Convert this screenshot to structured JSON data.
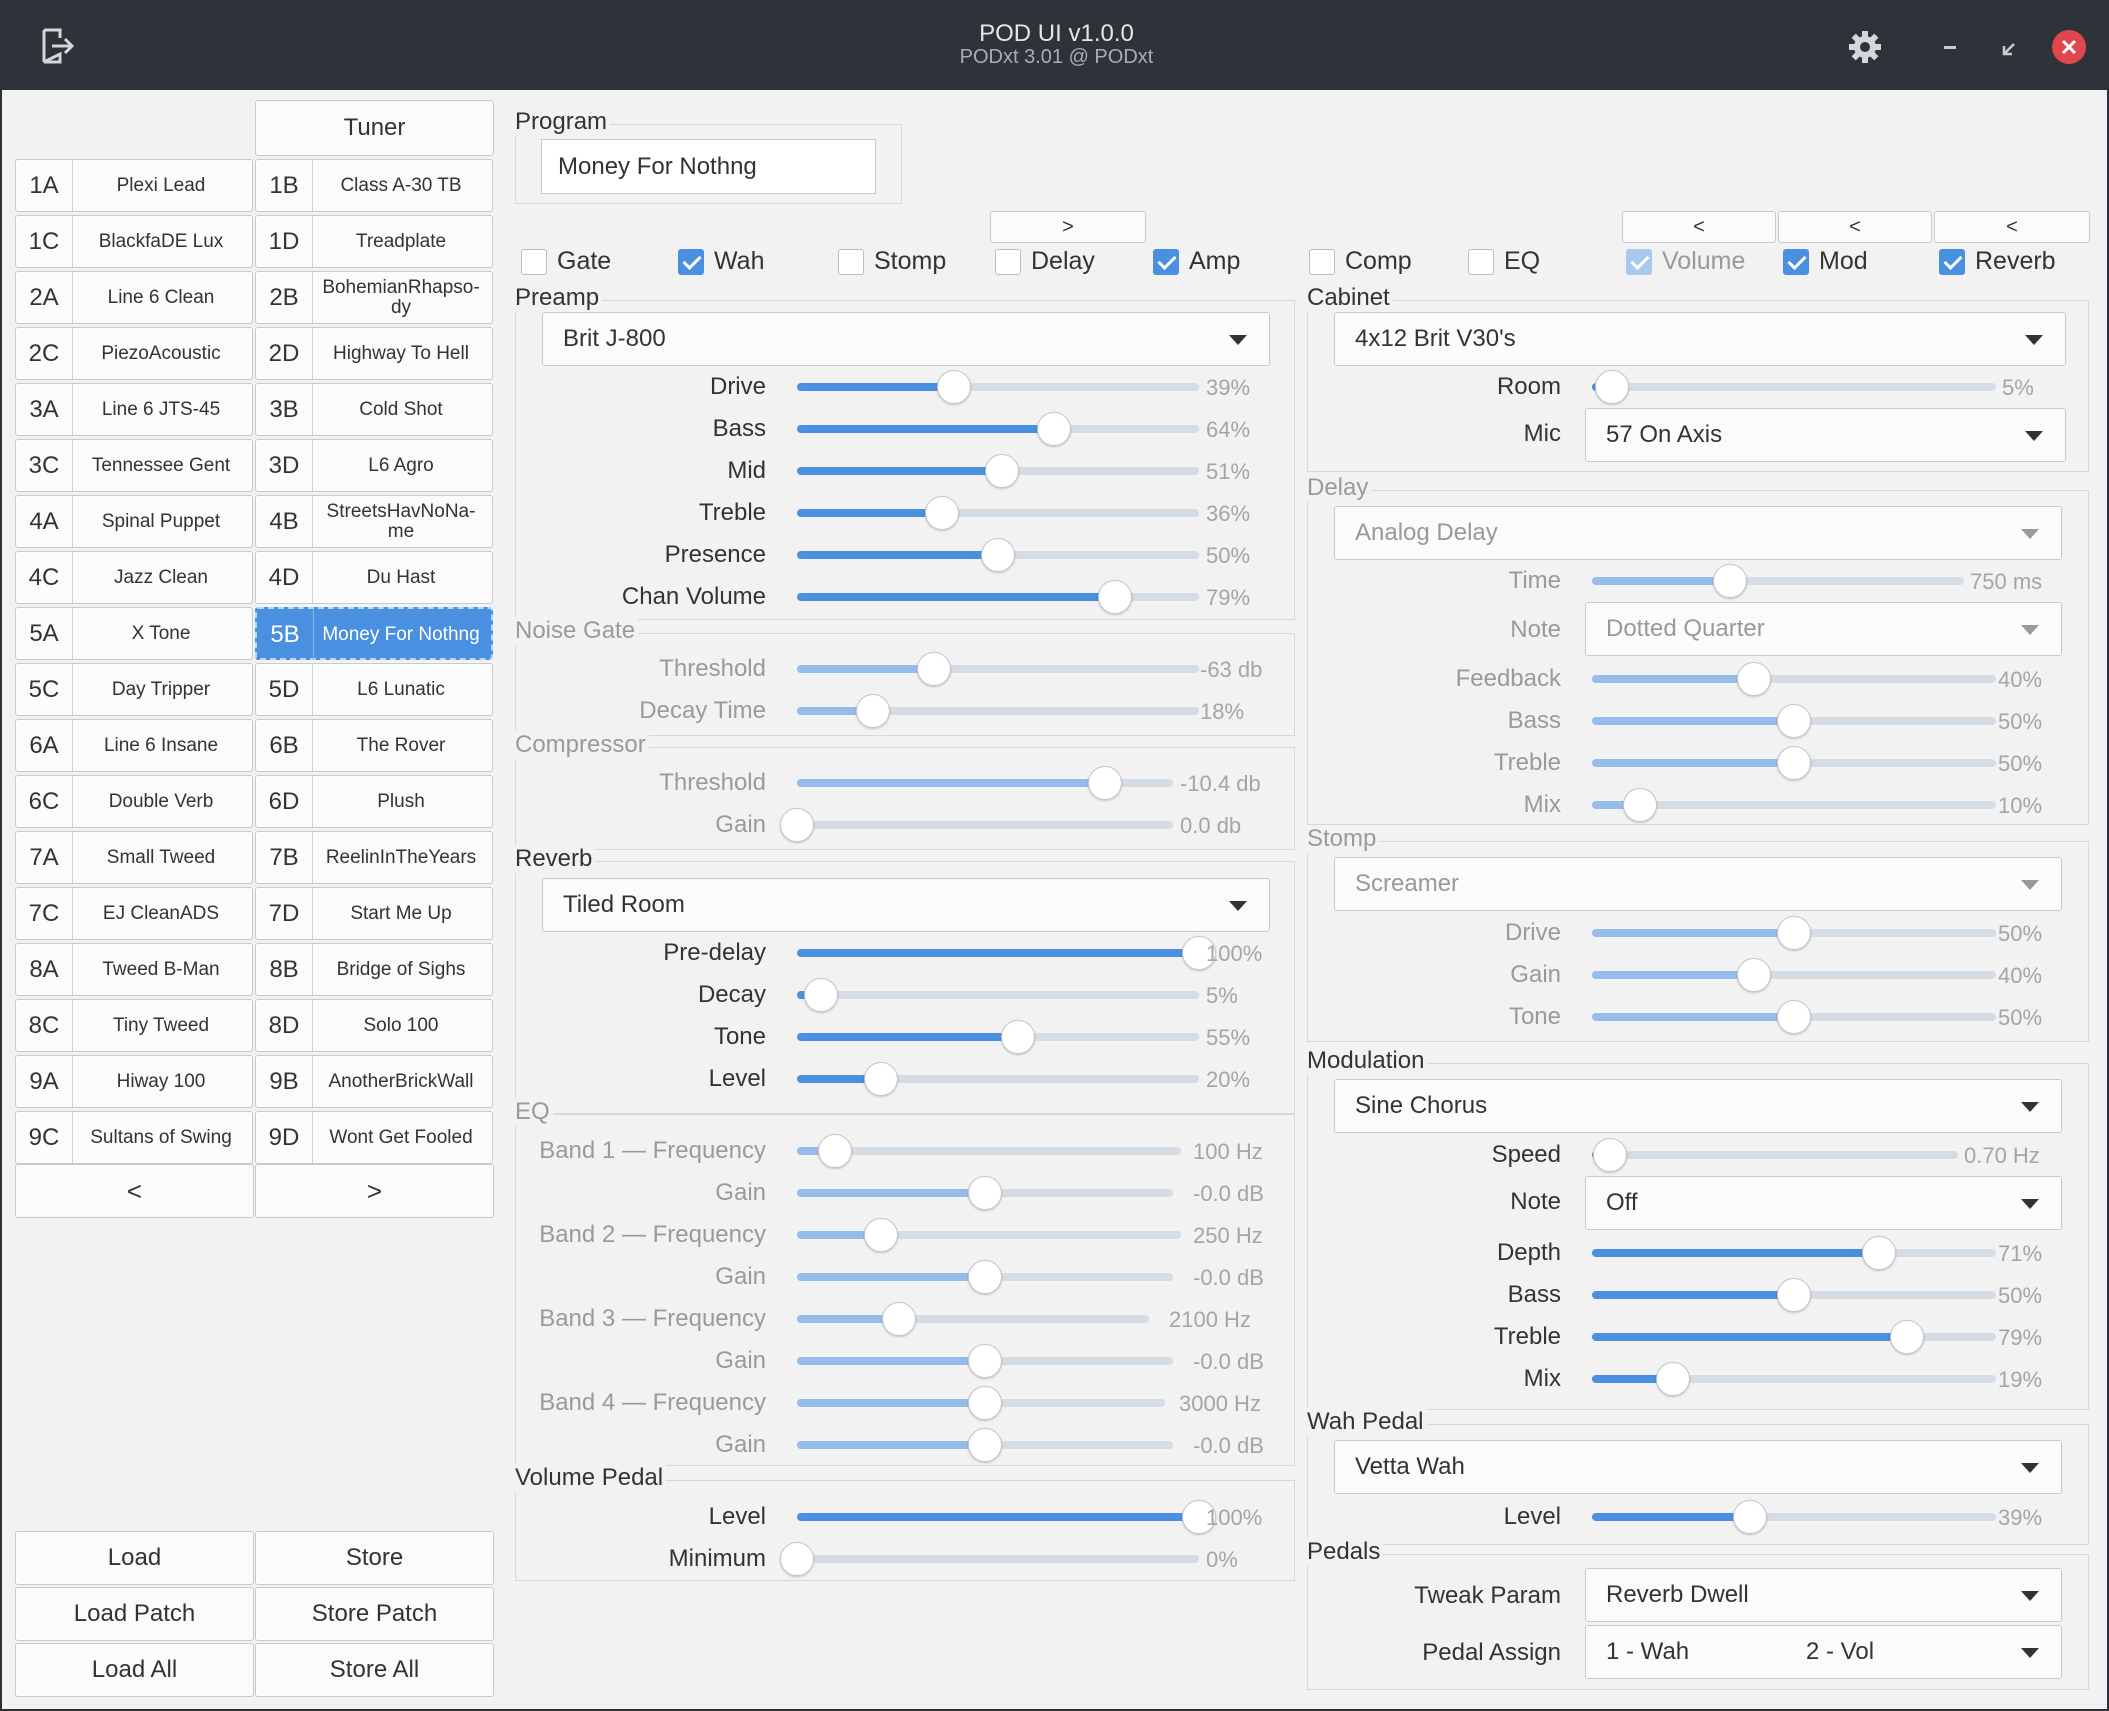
{
  "window": {
    "title": "POD UI v1.0.0",
    "subtitle": "PODxt 3.01 @ PODxt"
  },
  "icons": [
    "exit-icon",
    "gear-icon",
    "minimize-icon",
    "restore-icon",
    "close-icon",
    "chevron-down-icon",
    "checkbox-icon"
  ],
  "colors": {
    "accent": "#4a90e0",
    "titlebar": "#2f3339",
    "close": "#e0474c"
  },
  "sidebar": {
    "tuner": "Tuner",
    "patches": [
      {
        "code": "1A",
        "name": "Plexi Lead"
      },
      {
        "code": "1B",
        "name": "Class A-30 TB"
      },
      {
        "code": "1C",
        "name": "BlackfaDE Lux"
      },
      {
        "code": "1D",
        "name": "Treadplate"
      },
      {
        "code": "2A",
        "name": "Line 6 Clean"
      },
      {
        "code": "2B",
        "name": "BohemianRhapso-dy"
      },
      {
        "code": "2C",
        "name": "PiezoAcoustic"
      },
      {
        "code": "2D",
        "name": "Highway To Hell"
      },
      {
        "code": "3A",
        "name": "Line 6 JTS-45"
      },
      {
        "code": "3B",
        "name": "Cold Shot"
      },
      {
        "code": "3C",
        "name": "Tennessee Gent"
      },
      {
        "code": "3D",
        "name": "L6 Agro"
      },
      {
        "code": "4A",
        "name": "Spinal Puppet"
      },
      {
        "code": "4B",
        "name": "StreetsHavNoNa-me"
      },
      {
        "code": "4C",
        "name": "Jazz Clean"
      },
      {
        "code": "4D",
        "name": "Du Hast"
      },
      {
        "code": "5A",
        "name": "X Tone"
      },
      {
        "code": "5B",
        "name": "Money For Nothng"
      },
      {
        "code": "5C",
        "name": "Day Tripper"
      },
      {
        "code": "5D",
        "name": "L6 Lunatic"
      },
      {
        "code": "6A",
        "name": "Line 6 Insane"
      },
      {
        "code": "6B",
        "name": "The Rover"
      },
      {
        "code": "6C",
        "name": "Double Verb"
      },
      {
        "code": "6D",
        "name": "Plush"
      },
      {
        "code": "7A",
        "name": "Small Tweed"
      },
      {
        "code": "7B",
        "name": "ReelinInTheYears"
      },
      {
        "code": "7C",
        "name": "EJ CleanADS"
      },
      {
        "code": "7D",
        "name": "Start Me Up"
      },
      {
        "code": "8A",
        "name": "Tweed B-Man"
      },
      {
        "code": "8B",
        "name": "Bridge of Sighs"
      },
      {
        "code": "8C",
        "name": "Tiny Tweed"
      },
      {
        "code": "8D",
        "name": "Solo 100"
      },
      {
        "code": "9A",
        "name": "Hiway 100"
      },
      {
        "code": "9B",
        "name": "AnotherBrickWall"
      },
      {
        "code": "9C",
        "name": "Sultans of Swing"
      },
      {
        "code": "9D",
        "name": "Wont Get Fooled"
      }
    ],
    "selected": "5B",
    "prev": "<",
    "next": ">",
    "load": "Load",
    "store": "Store",
    "load_patch": "Load Patch",
    "store_patch": "Store Patch",
    "load_all": "Load All",
    "store_all": "Store All"
  },
  "program": {
    "label": "Program",
    "name": "Money For Nothng"
  },
  "move_buttons": [
    ">",
    "<",
    "<",
    "<"
  ],
  "fx_toggles": [
    {
      "label": "Gate",
      "checked": false
    },
    {
      "label": "Wah",
      "checked": true
    },
    {
      "label": "Stomp",
      "checked": false
    },
    {
      "label": "Delay",
      "checked": false
    },
    {
      "label": "Amp",
      "checked": true
    },
    {
      "label": "Comp",
      "checked": false
    },
    {
      "label": "EQ",
      "checked": false
    },
    {
      "label": "Volume",
      "checked": true,
      "disabled": true
    },
    {
      "label": "Mod",
      "checked": true
    },
    {
      "label": "Reverb",
      "checked": true
    }
  ],
  "preamp": {
    "label": "Preamp",
    "model": "Brit J-800",
    "params": [
      {
        "name": "Drive",
        "value": "39%",
        "level": 0.39
      },
      {
        "name": "Bass",
        "value": "64%",
        "level": 0.64
      },
      {
        "name": "Mid",
        "value": "51%",
        "level": 0.51
      },
      {
        "name": "Treble",
        "value": "36%",
        "level": 0.36
      },
      {
        "name": "Presence",
        "value": "50%",
        "level": 0.5
      },
      {
        "name": "Chan Volume",
        "value": "79%",
        "level": 0.79
      }
    ]
  },
  "noise_gate": {
    "label": "Noise Gate",
    "params": [
      {
        "name": "Threshold",
        "value": "-63 db",
        "level": 0.34
      },
      {
        "name": "Decay Time",
        "value": "18%",
        "level": 0.19
      }
    ]
  },
  "compressor": {
    "label": "Compressor",
    "params": [
      {
        "name": "Threshold",
        "value": "-10.4 db",
        "level": 0.82
      },
      {
        "name": "Gain",
        "value": "0.0 db",
        "level": 0.0
      }
    ]
  },
  "reverb": {
    "label": "Reverb",
    "model": "Tiled Room",
    "params": [
      {
        "name": "Pre-delay",
        "value": "100%",
        "level": 1.0
      },
      {
        "name": "Decay",
        "value": "5%",
        "level": 0.06
      },
      {
        "name": "Tone",
        "value": "55%",
        "level": 0.55
      },
      {
        "name": "Level",
        "value": "20%",
        "level": 0.21
      }
    ]
  },
  "eq": {
    "label": "EQ",
    "params": [
      {
        "name": "Band 1 — Frequency",
        "value": "100 Hz",
        "level": 0.1
      },
      {
        "name": "Gain",
        "value": "-0.0 dB",
        "level": 0.5
      },
      {
        "name": "Band 2 — Frequency",
        "value": "250 Hz",
        "level": 0.22
      },
      {
        "name": "Gain",
        "value": "-0.0 dB",
        "level": 0.5
      },
      {
        "name": "Band 3 — Frequency",
        "value": "2100 Hz",
        "level": 0.29
      },
      {
        "name": "Gain",
        "value": "-0.0 dB",
        "level": 0.5
      },
      {
        "name": "Band 4 — Frequency",
        "value": "3000 Hz",
        "level": 0.51
      },
      {
        "name": "Gain",
        "value": "-0.0 dB",
        "level": 0.5
      }
    ]
  },
  "volume_pedal": {
    "label": "Volume Pedal",
    "params": [
      {
        "name": "Level",
        "value": "100%",
        "level": 1.0
      },
      {
        "name": "Minimum",
        "value": "0%",
        "level": 0.0
      }
    ]
  },
  "cabinet": {
    "label": "Cabinet",
    "model": "4x12 Brit V30's",
    "room": {
      "name": "Room",
      "value": "5%",
      "level": 0.05
    },
    "mic_label": "Mic",
    "mic": "57 On Axis"
  },
  "delay": {
    "label": "Delay",
    "model": "Analog Delay",
    "time": {
      "name": "Time",
      "value": "750 ms",
      "level": 0.37
    },
    "note_label": "Note",
    "note": "Dotted Quarter",
    "params": [
      {
        "name": "Feedback",
        "value": "40%",
        "level": 0.4
      },
      {
        "name": "Bass",
        "value": "50%",
        "level": 0.5
      },
      {
        "name": "Treble",
        "value": "50%",
        "level": 0.5
      },
      {
        "name": "Mix",
        "value": "10%",
        "level": 0.12
      }
    ]
  },
  "stomp": {
    "label": "Stomp",
    "model": "Screamer",
    "params": [
      {
        "name": "Drive",
        "value": "50%",
        "level": 0.5
      },
      {
        "name": "Gain",
        "value": "40%",
        "level": 0.4
      },
      {
        "name": "Tone",
        "value": "50%",
        "level": 0.5
      }
    ]
  },
  "modulation": {
    "label": "Modulation",
    "model": "Sine Chorus",
    "speed": {
      "name": "Speed",
      "value": "0.70 Hz",
      "level": 0.05
    },
    "note_label": "Note",
    "note": "Off",
    "params": [
      {
        "name": "Depth",
        "value": "71%",
        "level": 0.71
      },
      {
        "name": "Bass",
        "value": "50%",
        "level": 0.5
      },
      {
        "name": "Treble",
        "value": "79%",
        "level": 0.78
      },
      {
        "name": "Mix",
        "value": "19%",
        "level": 0.2
      }
    ]
  },
  "wah": {
    "label": "Wah Pedal",
    "model": "Vetta Wah",
    "level": {
      "name": "Level",
      "value": "39%",
      "level": 0.39
    }
  },
  "pedals": {
    "label": "Pedals",
    "tweak_label": "Tweak Param",
    "tweak": "Reverb Dwell",
    "assign_label": "Pedal Assign",
    "assign_1": "1 - Wah",
    "assign_2": "2 - Vol"
  }
}
